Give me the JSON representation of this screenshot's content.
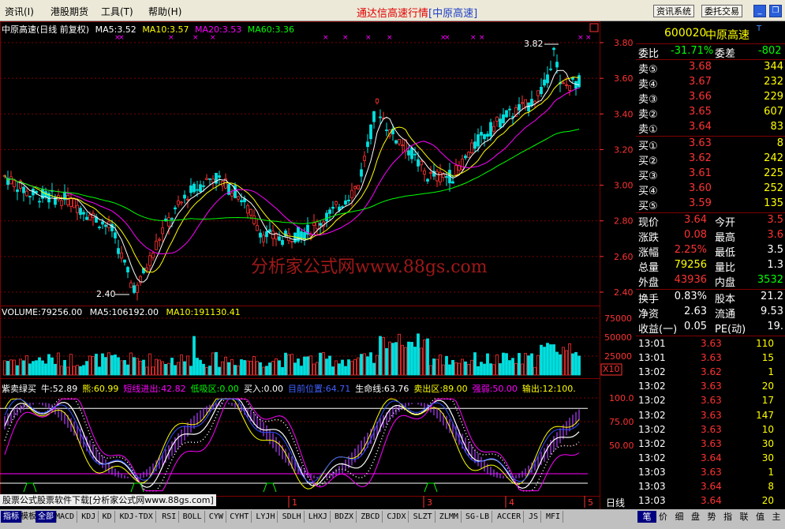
{
  "menu": [
    {
      "label": "资讯(I)"
    },
    {
      "label": "港股期货"
    },
    {
      "label": "工具(T)"
    },
    {
      "label": "帮助(H)"
    }
  ],
  "title": {
    "main": "通达信高速行情",
    "sub": "[中原高速]"
  },
  "top_buttons": [
    {
      "label": "资讯系统"
    },
    {
      "label": "委托交易"
    }
  ],
  "colors": {
    "up": "#ff3232",
    "down": "#00e0e0",
    "grid": "#800000",
    "ma5": "#ffffff",
    "ma10": "#ffff00",
    "ma20": "#ff00ff",
    "ma60": "#00ff00",
    "vol_up": "#ff3232",
    "vol_down": "#00e0e0"
  },
  "main_chart": {
    "header": {
      "name": "中原高速(日线 前复权)",
      "ma5": "MA5:3.52",
      "ma10": "MA10:3.57",
      "ma20": "MA20:3.53",
      "ma60": "MA60:3.36"
    },
    "y_ticks": [
      "3.80",
      "3.60",
      "3.40",
      "3.20",
      "3.00",
      "2.80",
      "2.60",
      "2.40"
    ],
    "low_label": "2.40",
    "high_label": "3.82",
    "watermark": "分析家公式网www.88gs.com",
    "volume_header": {
      "vol": "VOLUME:79256.00",
      "ma5": "MA5:106192.00",
      "ma10": "MA10:191130.41"
    },
    "volume_ticks": [
      "75000",
      "50000",
      "25000"
    ],
    "volume_unit": "X10",
    "indicator_header": [
      {
        "text": "紫卖绿买",
        "color": "#ffffff"
      },
      {
        "text": "牛:52.89",
        "color": "#ffffff"
      },
      {
        "text": "熊:60.99",
        "color": "#ffff00"
      },
      {
        "text": "短线进出:42.82",
        "color": "#ff00ff"
      },
      {
        "text": "低吸区:0.00",
        "color": "#00ff00"
      },
      {
        "text": "买入:0.00",
        "color": "#ffffff"
      },
      {
        "text": "目前位置:64.71",
        "color": "#4060ff"
      },
      {
        "text": "生命线:63.76",
        "color": "#ffffff"
      },
      {
        "text": "卖出区:89.00",
        "color": "#ffff00"
      },
      {
        "text": "强弱:50.00",
        "color": "#ff00ff"
      },
      {
        "text": "输出:12:100.",
        "color": "#ffff00"
      }
    ],
    "indicator_ticks": [
      "100.0",
      "75.00",
      "50.00"
    ],
    "x_labels": [
      "1",
      "3",
      "4",
      "5"
    ],
    "period": "日线",
    "marquee": "股票公式股票软件下载[分析家公式网www.88gs.com]"
  },
  "quote": {
    "code": "600020",
    "name": "中原高速",
    "badge": "T",
    "weibi": {
      "label": "委比",
      "value": "-31.71%",
      "label2": "委差",
      "value2": "-802"
    },
    "sell": [
      {
        "label": "卖⑤",
        "price": "3.68",
        "vol": "344"
      },
      {
        "label": "卖④",
        "price": "3.67",
        "vol": "232"
      },
      {
        "label": "卖③",
        "price": "3.66",
        "vol": "229"
      },
      {
        "label": "卖②",
        "price": "3.65",
        "vol": "607"
      },
      {
        "label": "卖①",
        "price": "3.64",
        "vol": "83"
      }
    ],
    "buy": [
      {
        "label": "买①",
        "price": "3.63",
        "vol": "8"
      },
      {
        "label": "买②",
        "price": "3.62",
        "vol": "242"
      },
      {
        "label": "买③",
        "price": "3.61",
        "vol": "225"
      },
      {
        "label": "买④",
        "price": "3.60",
        "vol": "252"
      },
      {
        "label": "买⑤",
        "price": "3.59",
        "vol": "135"
      }
    ],
    "stats": [
      {
        "l1": "现价",
        "v1": "3.64",
        "l2": "今开",
        "v2": "3.5"
      },
      {
        "l1": "涨跌",
        "v1": "0.08",
        "l2": "最高",
        "v2": "3.6"
      },
      {
        "l1": "涨幅",
        "v1": "2.25%",
        "l2": "最低",
        "v2": "3.5"
      },
      {
        "l1": "总量",
        "v1": "79256",
        "l2": "量比",
        "v2": "1.3"
      },
      {
        "l1": "外盘",
        "v1": "43936",
        "l2": "内盘",
        "v2": "3532"
      }
    ],
    "stats2": [
      {
        "l1": "换手",
        "v1": "0.83%",
        "l2": "股本",
        "v2": "21.2"
      },
      {
        "l1": "净资",
        "v1": "2.63",
        "l2": "流通",
        "v2": "9.53"
      },
      {
        "l1": "收益(一)",
        "v1": "0.05",
        "l2": "PE(动)",
        "v2": "19."
      }
    ],
    "ticks": [
      {
        "t": "13:01",
        "p": "3.63",
        "v": "110"
      },
      {
        "t": "13:01",
        "p": "3.63",
        "v": "15"
      },
      {
        "t": "13:02",
        "p": "3.62",
        "v": "1"
      },
      {
        "t": "13:02",
        "p": "3.63",
        "v": "20"
      },
      {
        "t": "13:02",
        "p": "3.63",
        "v": "17"
      },
      {
        "t": "13:02",
        "p": "3.63",
        "v": "147"
      },
      {
        "t": "13:02",
        "p": "3.63",
        "v": "10"
      },
      {
        "t": "13:02",
        "p": "3.63",
        "v": "30"
      },
      {
        "t": "13:02",
        "p": "3.64",
        "v": "30"
      },
      {
        "t": "13:03",
        "p": "3.63",
        "v": "1"
      },
      {
        "t": "13:03",
        "p": "3.64",
        "v": "8"
      },
      {
        "t": "13:03",
        "p": "3.64",
        "v": "20"
      }
    ]
  },
  "bottom_tabs": [
    "指标",
    "模板",
    "全部",
    "MACD",
    "KDJ",
    "KD",
    "KDJ-TDX",
    "RSI",
    "BOLL",
    "CYW",
    "CYHT",
    "LYJH",
    "SDLH",
    "LHXJ",
    "BDZX",
    "ZBCD",
    "CJDX",
    "SLZT",
    "ZLMM",
    "SG-LB",
    "ACCER",
    "JS",
    "MFI"
  ],
  "side_tabs": [
    "笔",
    "价",
    "细",
    "盘",
    "势",
    "指",
    "联",
    "值",
    "主"
  ]
}
